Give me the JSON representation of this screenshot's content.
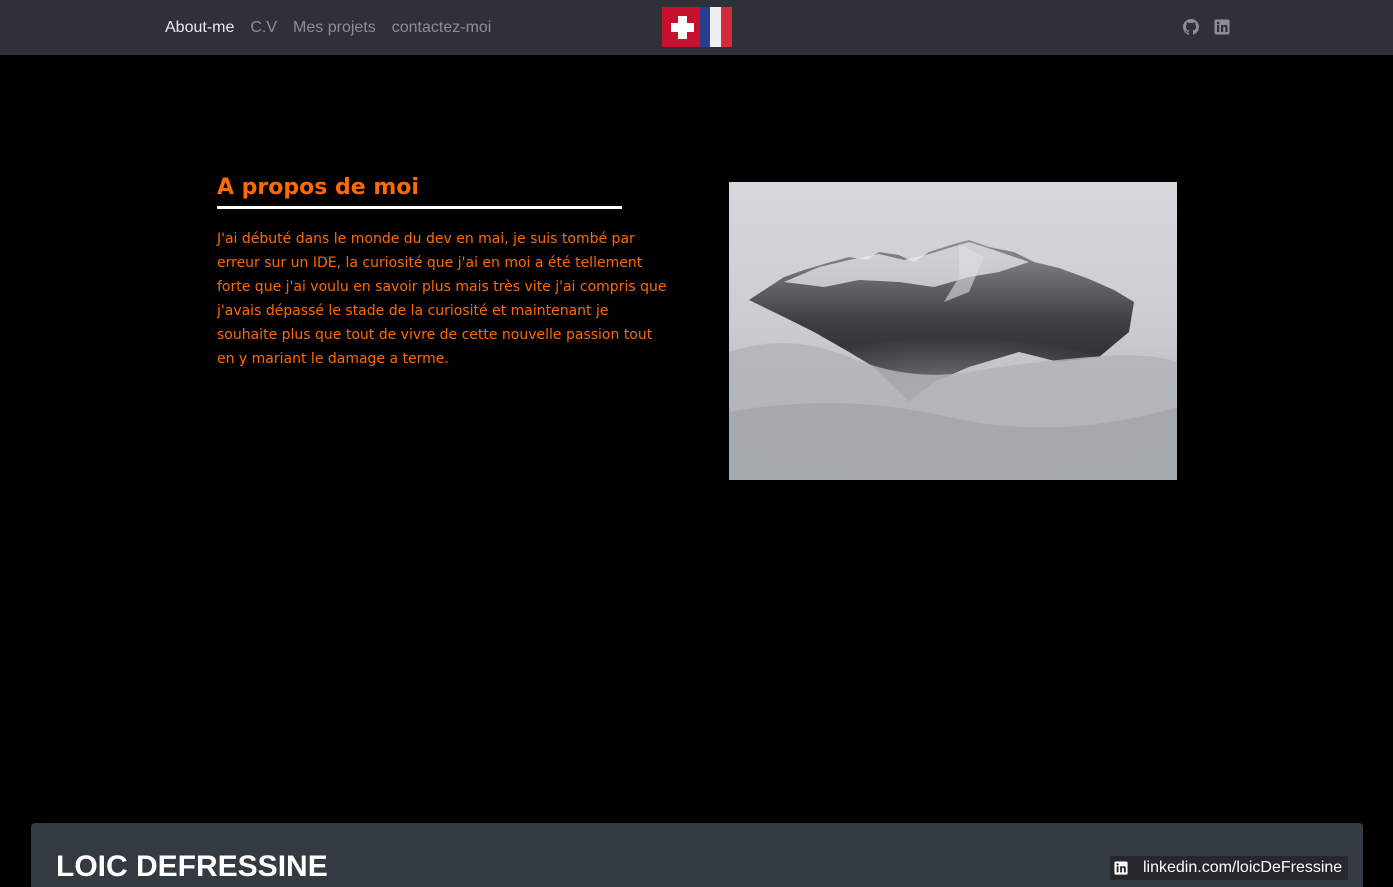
{
  "navbar": {
    "links": [
      {
        "label": "About-me",
        "active": true
      },
      {
        "label": "C.V",
        "active": false
      },
      {
        "label": "Mes projets",
        "active": false
      },
      {
        "label": "contactez-moi",
        "active": false
      }
    ],
    "logo_icon": "swiss-french-flag-icon",
    "social_icons": [
      "github-icon",
      "linkedin-icon"
    ]
  },
  "about": {
    "title": "A propos de moi",
    "text": "J'ai débuté dans le monde du dev en mai, je suis tombé par erreur sur un IDE, la curiosité que j'ai en moi a été tellement forte que j'ai voulu en savoir plus mais très vite j'ai compris que j'avais dépassé le stade de la curiosité et maintenant je souhaite plus que tout de vivre de cette nouvelle passion tout en y mariant le damage a terme.",
    "image_icon": "mountain-in-clouds-photo"
  },
  "footer": {
    "name": "LOIC DEFRESSINE",
    "linkedin_text": "linkedin.com/loicDeFressine",
    "linkedin_icon": "linkedin-icon"
  },
  "colors": {
    "navbar_bg": "#2e3238",
    "page_bg": "#000000",
    "accent": "#ff6a00",
    "footer_bg": "#343a41"
  }
}
